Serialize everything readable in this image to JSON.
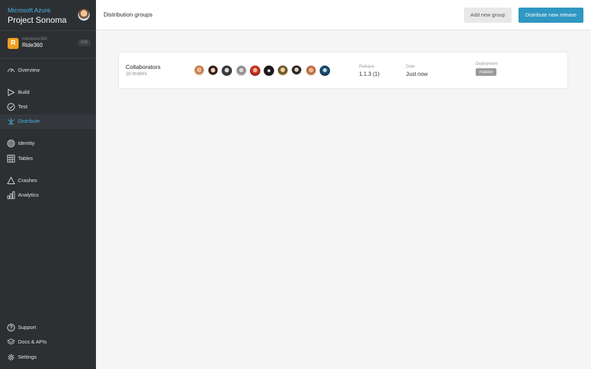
{
  "brand": {
    "org": "Microsoft Azure",
    "project": "Project Sonoma"
  },
  "app": {
    "badge_letter": "R",
    "owner": "ridestores360",
    "name": "Ride360",
    "os": "iOS"
  },
  "nav": {
    "overview": "Overview",
    "build": "Build",
    "test": "Test",
    "distribute": "Distribute",
    "identity": "Identity",
    "tables": "Tables",
    "crashes": "Crashes",
    "analytics": "Analytics",
    "support": "Support",
    "docs": "Docs & APIs",
    "settings": "Settings"
  },
  "header": {
    "title": "Distribution groups",
    "add_group": "Add new group",
    "distribute": "Distribute new release"
  },
  "group": {
    "name": "Collaborators",
    "testers_count": "10 testers",
    "release_label": "Release",
    "release_value": "1.1.3 (1)",
    "date_label": "Date",
    "date_value": "Just now",
    "deployment_label": "Deployment",
    "deployment_value": "master"
  },
  "colors": {
    "accent": "#2f97c2",
    "sidebar_bg": "#2d3033",
    "active_text": "#4ab3e3"
  }
}
